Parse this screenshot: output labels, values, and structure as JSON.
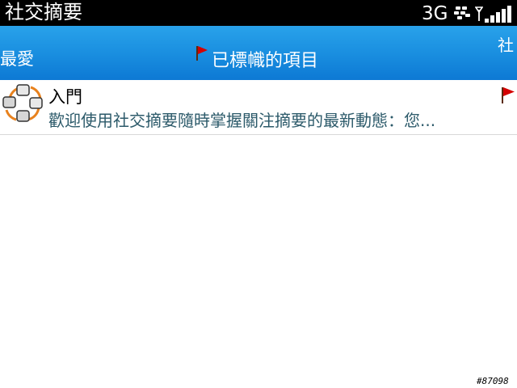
{
  "status_bar": {
    "app_title": "社交摘要",
    "network": "3G",
    "icons": [
      "blackberry-logo-icon",
      "antenna-icon",
      "signal-strength-icon"
    ]
  },
  "tabs": {
    "left": "最愛",
    "center": "已標幟的項目",
    "right": "社"
  },
  "items": [
    {
      "title": "入門",
      "summary": "歡迎使用社交摘要隨時掌握關注摘要的最新動態：您...",
      "flagged": true
    }
  ],
  "watermark": "#87098",
  "colors": {
    "status_bar_bg": "#000000",
    "tab_bar_bg": "#1a8fe0",
    "flag_red": "#d40000",
    "summary_text": "#2c5a6a",
    "icon_orange": "#e8821e"
  }
}
